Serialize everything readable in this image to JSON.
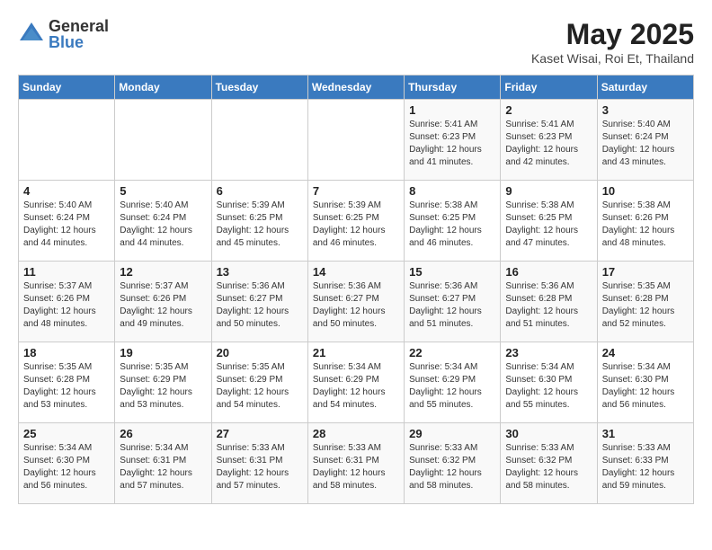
{
  "logo": {
    "general": "General",
    "blue": "Blue"
  },
  "title": "May 2025",
  "location": "Kaset Wisai, Roi Et, Thailand",
  "days_of_week": [
    "Sunday",
    "Monday",
    "Tuesday",
    "Wednesday",
    "Thursday",
    "Friday",
    "Saturday"
  ],
  "weeks": [
    [
      {
        "day": "",
        "info": ""
      },
      {
        "day": "",
        "info": ""
      },
      {
        "day": "",
        "info": ""
      },
      {
        "day": "",
        "info": ""
      },
      {
        "day": "1",
        "info": "Sunrise: 5:41 AM\nSunset: 6:23 PM\nDaylight: 12 hours\nand 41 minutes."
      },
      {
        "day": "2",
        "info": "Sunrise: 5:41 AM\nSunset: 6:23 PM\nDaylight: 12 hours\nand 42 minutes."
      },
      {
        "day": "3",
        "info": "Sunrise: 5:40 AM\nSunset: 6:24 PM\nDaylight: 12 hours\nand 43 minutes."
      }
    ],
    [
      {
        "day": "4",
        "info": "Sunrise: 5:40 AM\nSunset: 6:24 PM\nDaylight: 12 hours\nand 44 minutes."
      },
      {
        "day": "5",
        "info": "Sunrise: 5:40 AM\nSunset: 6:24 PM\nDaylight: 12 hours\nand 44 minutes."
      },
      {
        "day": "6",
        "info": "Sunrise: 5:39 AM\nSunset: 6:25 PM\nDaylight: 12 hours\nand 45 minutes."
      },
      {
        "day": "7",
        "info": "Sunrise: 5:39 AM\nSunset: 6:25 PM\nDaylight: 12 hours\nand 46 minutes."
      },
      {
        "day": "8",
        "info": "Sunrise: 5:38 AM\nSunset: 6:25 PM\nDaylight: 12 hours\nand 46 minutes."
      },
      {
        "day": "9",
        "info": "Sunrise: 5:38 AM\nSunset: 6:25 PM\nDaylight: 12 hours\nand 47 minutes."
      },
      {
        "day": "10",
        "info": "Sunrise: 5:38 AM\nSunset: 6:26 PM\nDaylight: 12 hours\nand 48 minutes."
      }
    ],
    [
      {
        "day": "11",
        "info": "Sunrise: 5:37 AM\nSunset: 6:26 PM\nDaylight: 12 hours\nand 48 minutes."
      },
      {
        "day": "12",
        "info": "Sunrise: 5:37 AM\nSunset: 6:26 PM\nDaylight: 12 hours\nand 49 minutes."
      },
      {
        "day": "13",
        "info": "Sunrise: 5:36 AM\nSunset: 6:27 PM\nDaylight: 12 hours\nand 50 minutes."
      },
      {
        "day": "14",
        "info": "Sunrise: 5:36 AM\nSunset: 6:27 PM\nDaylight: 12 hours\nand 50 minutes."
      },
      {
        "day": "15",
        "info": "Sunrise: 5:36 AM\nSunset: 6:27 PM\nDaylight: 12 hours\nand 51 minutes."
      },
      {
        "day": "16",
        "info": "Sunrise: 5:36 AM\nSunset: 6:28 PM\nDaylight: 12 hours\nand 51 minutes."
      },
      {
        "day": "17",
        "info": "Sunrise: 5:35 AM\nSunset: 6:28 PM\nDaylight: 12 hours\nand 52 minutes."
      }
    ],
    [
      {
        "day": "18",
        "info": "Sunrise: 5:35 AM\nSunset: 6:28 PM\nDaylight: 12 hours\nand 53 minutes."
      },
      {
        "day": "19",
        "info": "Sunrise: 5:35 AM\nSunset: 6:29 PM\nDaylight: 12 hours\nand 53 minutes."
      },
      {
        "day": "20",
        "info": "Sunrise: 5:35 AM\nSunset: 6:29 PM\nDaylight: 12 hours\nand 54 minutes."
      },
      {
        "day": "21",
        "info": "Sunrise: 5:34 AM\nSunset: 6:29 PM\nDaylight: 12 hours\nand 54 minutes."
      },
      {
        "day": "22",
        "info": "Sunrise: 5:34 AM\nSunset: 6:29 PM\nDaylight: 12 hours\nand 55 minutes."
      },
      {
        "day": "23",
        "info": "Sunrise: 5:34 AM\nSunset: 6:30 PM\nDaylight: 12 hours\nand 55 minutes."
      },
      {
        "day": "24",
        "info": "Sunrise: 5:34 AM\nSunset: 6:30 PM\nDaylight: 12 hours\nand 56 minutes."
      }
    ],
    [
      {
        "day": "25",
        "info": "Sunrise: 5:34 AM\nSunset: 6:30 PM\nDaylight: 12 hours\nand 56 minutes."
      },
      {
        "day": "26",
        "info": "Sunrise: 5:34 AM\nSunset: 6:31 PM\nDaylight: 12 hours\nand 57 minutes."
      },
      {
        "day": "27",
        "info": "Sunrise: 5:33 AM\nSunset: 6:31 PM\nDaylight: 12 hours\nand 57 minutes."
      },
      {
        "day": "28",
        "info": "Sunrise: 5:33 AM\nSunset: 6:31 PM\nDaylight: 12 hours\nand 58 minutes."
      },
      {
        "day": "29",
        "info": "Sunrise: 5:33 AM\nSunset: 6:32 PM\nDaylight: 12 hours\nand 58 minutes."
      },
      {
        "day": "30",
        "info": "Sunrise: 5:33 AM\nSunset: 6:32 PM\nDaylight: 12 hours\nand 58 minutes."
      },
      {
        "day": "31",
        "info": "Sunrise: 5:33 AM\nSunset: 6:33 PM\nDaylight: 12 hours\nand 59 minutes."
      }
    ]
  ]
}
